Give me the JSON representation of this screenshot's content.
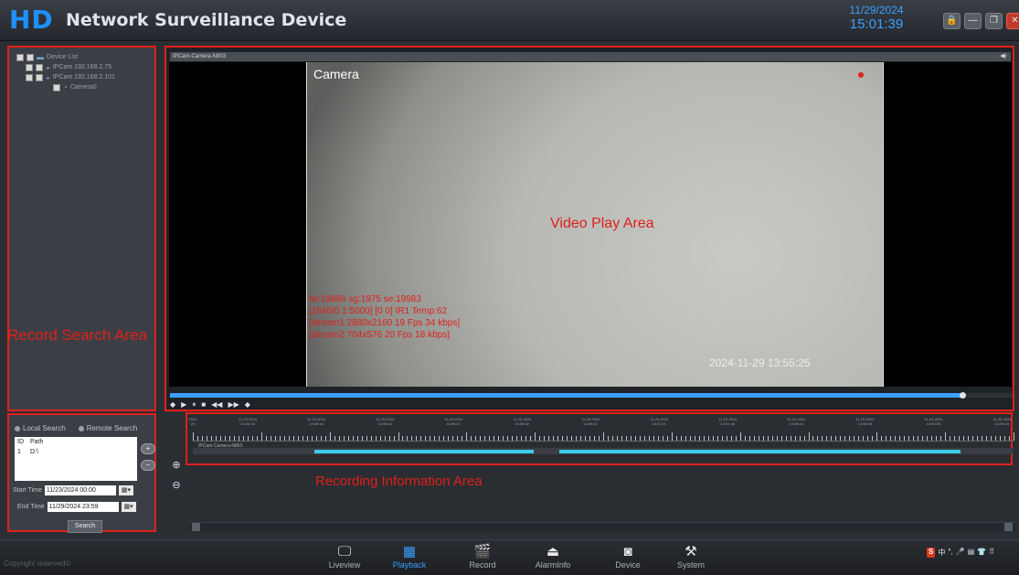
{
  "header": {
    "logo_text": "HD",
    "title": "Network Surveillance Device",
    "date": "11/29/2024",
    "time": "15:01:39",
    "window_buttons": [
      {
        "name": "lock-icon",
        "glyph": "🔒"
      },
      {
        "name": "minimize-icon",
        "glyph": "—"
      },
      {
        "name": "restore-icon",
        "glyph": "❐"
      },
      {
        "name": "close-icon",
        "glyph": "✕"
      }
    ]
  },
  "device_tree": {
    "items": [
      {
        "label": "Device List",
        "level": 0
      },
      {
        "label": "IPCam 192.168.2.75",
        "level": 1
      },
      {
        "label": "IPCam 192.168.2.101",
        "level": 1
      },
      {
        "label": "Camera0",
        "level": 2
      }
    ]
  },
  "annotations": {
    "record_search": "Record Search Area",
    "video_play": "Video Play Area",
    "recording_info": "Recording Information Area"
  },
  "search": {
    "local_label": "Local Search",
    "remote_label": "Remote Search",
    "col_id": "ID",
    "col_path": "Path",
    "rows": [
      {
        "id": "1",
        "path": "D:\\"
      }
    ],
    "add_glyph": "+",
    "remove_glyph": "−",
    "start_label": "Start Time",
    "start_value": "11/23/2024 00:00",
    "end_label": "End Time",
    "end_value": "11/29/2024 23:59",
    "calendar_glyph": "▦▾",
    "search_button": "Search"
  },
  "video": {
    "window_title": "IPCam-Camera-N803",
    "speaker_glyph": "◀›",
    "camera_name": "Camera",
    "osd_lines": [
      "fw:19886 sg:1975 se:19983",
      "[1840/0 1:5000] [0 0] IR1 Temp:62",
      "[stream1 2880x2160 19 Fps 34 kbps]",
      "[stream2 704x576 20 Fps 18 kbps]"
    ],
    "timestamp": "2024-11-29 13:55:25",
    "playback_progress": 0.94,
    "controls": [
      "◆",
      "▶",
      "⏸",
      "■",
      "◀◀",
      "▶▶",
      "◆"
    ]
  },
  "timeline": {
    "track_name": "IPCam-Camera-N803",
    "ticks": [
      {
        "date": "11-29-2024",
        "time": "13:54:33"
      },
      {
        "date": "11-29-2024",
        "time": "13:55:18"
      },
      {
        "date": "11-29-2024",
        "time": "13:55:43"
      },
      {
        "date": "11-29-2024",
        "time": "13:56:07"
      },
      {
        "date": "11-29-2024",
        "time": "13:56:32"
      },
      {
        "date": "11-29-2024",
        "time": "13:56:57"
      },
      {
        "date": "11-29-2024",
        "time": "13:57:21"
      },
      {
        "date": "11-29-2024",
        "time": "13:57:46"
      },
      {
        "date": "11-29-2024",
        "time": "13:58:10"
      },
      {
        "date": "11-29-2024",
        "time": "13:58:35"
      },
      {
        "date": "11-29-2024",
        "time": "13:59:00"
      },
      {
        "date": "11-29-2024",
        "time": "13:59:24"
      }
    ],
    "first_tick": {
      "date": "2024",
      "time": "29"
    },
    "segments": [
      {
        "start": 0.148,
        "end": 0.415
      },
      {
        "start": 0.447,
        "end": 0.935
      }
    ],
    "zoom_in_glyph": "⊕",
    "zoom_out_glyph": "⊖"
  },
  "nav": {
    "items": [
      {
        "label": "Liveview",
        "icon": "monitor-icon",
        "glyph": "🖵",
        "active": false
      },
      {
        "label": "Playback",
        "icon": "playback-icon",
        "glyph": "▦",
        "active": true
      },
      {
        "label": "Record",
        "icon": "clapperboard-icon",
        "glyph": "🎬",
        "active": false
      },
      {
        "label": "AlarmInfo",
        "icon": "alarm-light-icon",
        "glyph": "⏏",
        "active": false
      },
      {
        "label": "Device",
        "icon": "camera-device-icon",
        "glyph": "◙",
        "active": false
      },
      {
        "label": "System",
        "icon": "tools-icon",
        "glyph": "⚒",
        "active": false
      }
    ],
    "copyright": "Copyright reserved©",
    "tray": [
      "S",
      "中",
      "°,",
      "🎤",
      "▤",
      "👕",
      "⠿"
    ]
  }
}
